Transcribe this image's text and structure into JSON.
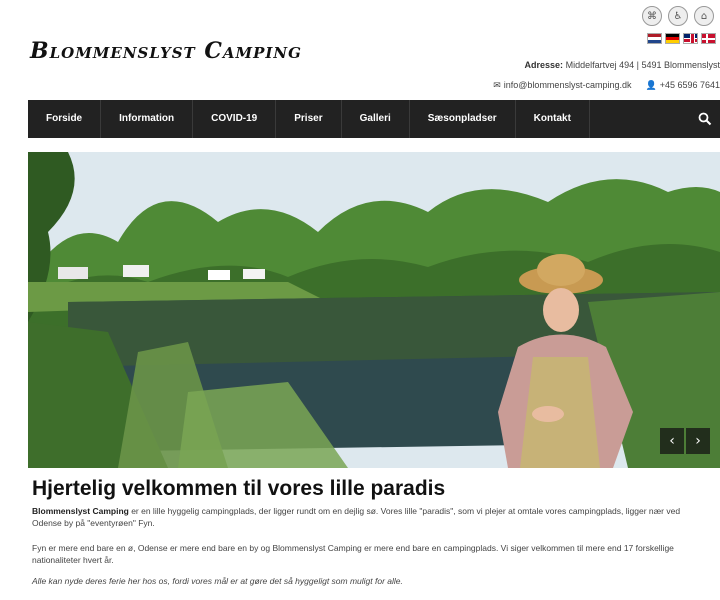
{
  "site": {
    "logo_text": "Blommenslyst Camping"
  },
  "top_icons": [
    "sitemap-icon",
    "accessibility-icon",
    "home-icon"
  ],
  "languages": [
    "NL",
    "DE",
    "EN",
    "DK"
  ],
  "address": {
    "label": "Adresse:",
    "value": "Middelfartvej 494 | 5491 Blommenslyst"
  },
  "contact": {
    "email": "info@blommenslyst-camping.dk",
    "phone": "+45 6596 7641"
  },
  "nav": {
    "items": [
      "Forside",
      "Information",
      "COVID-19",
      "Priser",
      "Galleri",
      "Sæsonpladser",
      "Kontakt"
    ]
  },
  "hero": {
    "prev_label": "‹",
    "next_label": "›"
  },
  "content": {
    "headline": "Hjertelig velkommen til vores lille paradis",
    "p1_strong": "Blommenslyst Camping",
    "p1_rest": " er en lille hyggelig campingplads, der ligger rundt om en dejlig sø. Vores lille \"paradis\", som vi plejer at omtale vores campingplads, ligger nær ved Odense by på \"eventyrøen\" Fyn.",
    "p2": "Fyn er mere end bare en ø, Odense er mere end bare en by og Blommenslyst Camping er mere end bare en campingplads. Vi siger velkommen til mere end 17 forskellige nationaliteter hvert år.",
    "p3": "Alle kan nyde deres ferie her hos os, fordi vores mål er at gøre det så hyggeligt som muligt for alle."
  }
}
